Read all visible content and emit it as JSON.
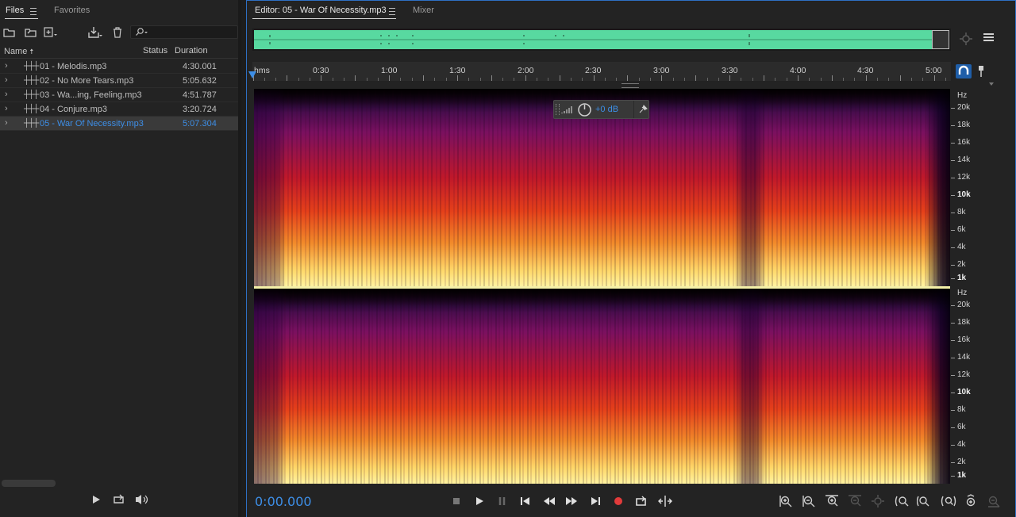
{
  "files_panel": {
    "tabs": [
      {
        "label": "Files"
      },
      {
        "label": "Favorites"
      }
    ],
    "columns": {
      "name": "Name",
      "status": "Status",
      "duration": "Duration"
    },
    "search_placeholder": "",
    "files": [
      {
        "name": "01 - Melodis.mp3",
        "duration": "4:30.001",
        "selected": false
      },
      {
        "name": "02 - No More Tears.mp3",
        "duration": "5:05.632",
        "selected": false
      },
      {
        "name": "03 - Wa...ing, Feeling.mp3",
        "duration": "4:51.787",
        "selected": false
      },
      {
        "name": "04 - Conjure.mp3",
        "duration": "3:20.724",
        "selected": false
      },
      {
        "name": "05 - War Of Necessity.mp3",
        "duration": "5:07.304",
        "selected": true
      }
    ]
  },
  "editor": {
    "tabs": [
      {
        "label": "Editor: 05 - War Of Necessity.mp3"
      },
      {
        "label": "Mixer"
      }
    ],
    "ruler": {
      "unit_label": "hms",
      "ticks": [
        "0:30",
        "1:00",
        "1:30",
        "2:00",
        "2:30",
        "3:00",
        "3:30",
        "4:00",
        "4:30",
        "5:00"
      ]
    },
    "hud": {
      "gain_label": "+0 dB"
    },
    "freq_axis": {
      "unit": "Hz",
      "labels": [
        "20k",
        "18k",
        "16k",
        "14k",
        "12k",
        "10k",
        "8k",
        "6k",
        "4k",
        "2k",
        "1k"
      ],
      "bold_labels": [
        "10k",
        "1k"
      ]
    },
    "time_display": "0:00.000"
  },
  "colors": {
    "accent": "#3d8ee6",
    "waveform_overview": "#58d9a0",
    "spectrogram_hot": "#ffd86a",
    "spectrogram_mid": "#e8321a",
    "spectrogram_cool": "#5a1a7a",
    "record": "#e23b3b"
  },
  "icons": {
    "transport": [
      "stop-icon",
      "play-icon",
      "pause-icon",
      "go-to-start-icon",
      "rewind-icon",
      "fast-forward-icon",
      "go-to-end-icon",
      "record-icon",
      "loop-icon",
      "skip-selection-icon"
    ],
    "zoom": [
      "zoom-in-amplitude-icon",
      "zoom-out-amplitude-icon",
      "zoom-in-time-icon",
      "zoom-out-time-icon",
      "zoom-full-icon",
      "zoom-in-left-icon",
      "zoom-in-right-icon",
      "zoom-to-selection-icon",
      "zoom-in-frequency-icon",
      "zoom-out-frequency-icon"
    ]
  }
}
